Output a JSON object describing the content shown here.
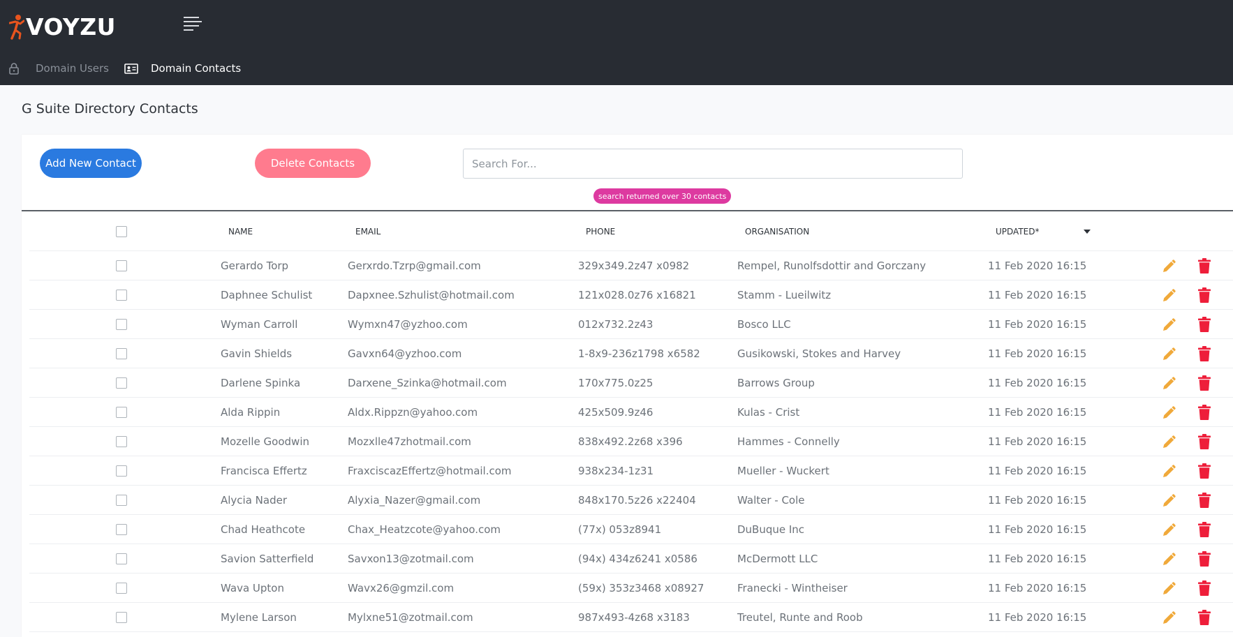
{
  "app": {
    "logo_text": "VOYZU"
  },
  "nav": {
    "users_label": "Domain Users",
    "contacts_label": "Domain Contacts"
  },
  "page": {
    "title": "G Suite Directory Contacts"
  },
  "toolbar": {
    "add_label": "Add New Contact",
    "delete_label": "Delete Contacts",
    "search_placeholder": "Search For...",
    "search_value": "",
    "result_badge": "search returned over 30 contacts"
  },
  "table": {
    "headers": {
      "name": "NAME",
      "email": "EMAIL",
      "phone": "PHONE",
      "org": "ORGANISATION",
      "updated": "UPDATED*"
    },
    "rows": [
      {
        "name": "Gerardo Torp",
        "email": "Gerxrdo.Tzrp@gmail.com",
        "phone": "329x349.2z47 x0982",
        "org": "Rempel, Runolfsdottir and Gorczany",
        "updated": "11 Feb 2020 16:15"
      },
      {
        "name": "Daphnee Schulist",
        "email": "Dapxnee.Szhulist@hotmail.com",
        "phone": "121x028.0z76 x16821",
        "org": "Stamm - Lueilwitz",
        "updated": "11 Feb 2020 16:15"
      },
      {
        "name": "Wyman Carroll",
        "email": "Wymxn47@yzhoo.com",
        "phone": "012x732.2z43",
        "org": "Bosco LLC",
        "updated": "11 Feb 2020 16:15"
      },
      {
        "name": "Gavin Shields",
        "email": "Gavxn64@yzhoo.com",
        "phone": "1-8x9-236z1798 x6582",
        "org": "Gusikowski, Stokes and Harvey",
        "updated": "11 Feb 2020 16:15"
      },
      {
        "name": "Darlene Spinka",
        "email": "Darxene_Szinka@hotmail.com",
        "phone": "170x775.0z25",
        "org": "Barrows Group",
        "updated": "11 Feb 2020 16:15"
      },
      {
        "name": "Alda Rippin",
        "email": "Aldx.Rippzn@yahoo.com",
        "phone": "425x509.9z46",
        "org": "Kulas - Crist",
        "updated": "11 Feb 2020 16:15"
      },
      {
        "name": "Mozelle Goodwin",
        "email": "Mozxlle47zhotmail.com",
        "phone": "838x492.2z68 x396",
        "org": "Hammes - Connelly",
        "updated": "11 Feb 2020 16:15"
      },
      {
        "name": "Francisca Effertz",
        "email": "FraxciscazEffertz@hotmail.com",
        "phone": "938x234-1z31",
        "org": "Mueller - Wuckert",
        "updated": "11 Feb 2020 16:15"
      },
      {
        "name": "Alycia Nader",
        "email": "Alyxia_Nazer@gmail.com",
        "phone": "848x170.5z26 x22404",
        "org": "Walter - Cole",
        "updated": "11 Feb 2020 16:15"
      },
      {
        "name": "Chad Heathcote",
        "email": "Chax_Heatzcote@yahoo.com",
        "phone": "(77x) 053z8941",
        "org": "DuBuque Inc",
        "updated": "11 Feb 2020 16:15"
      },
      {
        "name": "Savion Satterfield",
        "email": "Savxon13@zotmail.com",
        "phone": "(94x) 434z6241 x0586",
        "org": "McDermott LLC",
        "updated": "11 Feb 2020 16:15"
      },
      {
        "name": "Wava Upton",
        "email": "Wavx26@gmzil.com",
        "phone": "(59x) 353z3468 x08927",
        "org": "Franecki - Wintheiser",
        "updated": "11 Feb 2020 16:15"
      },
      {
        "name": "Mylene Larson",
        "email": "Mylxne51@zotmail.com",
        "phone": "987x493-4z68 x3183",
        "org": "Treutel, Runte and Roob",
        "updated": "11 Feb 2020 16:15"
      }
    ]
  },
  "colors": {
    "topbar": "#282c33",
    "primary": "#2a7ae0",
    "danger_button": "#ff7b8e",
    "badge": "#dd3aa0",
    "edit_icon": "#f0a93a",
    "delete_icon": "#ee1e3a"
  },
  "icons": {
    "logo": "running-figure-icon",
    "menu": "hamburger-menu-icon",
    "users": "lock-icon",
    "contacts": "contact-card-icon",
    "edit": "pencil-icon",
    "delete": "trash-icon",
    "sort": "caret-down-icon"
  }
}
